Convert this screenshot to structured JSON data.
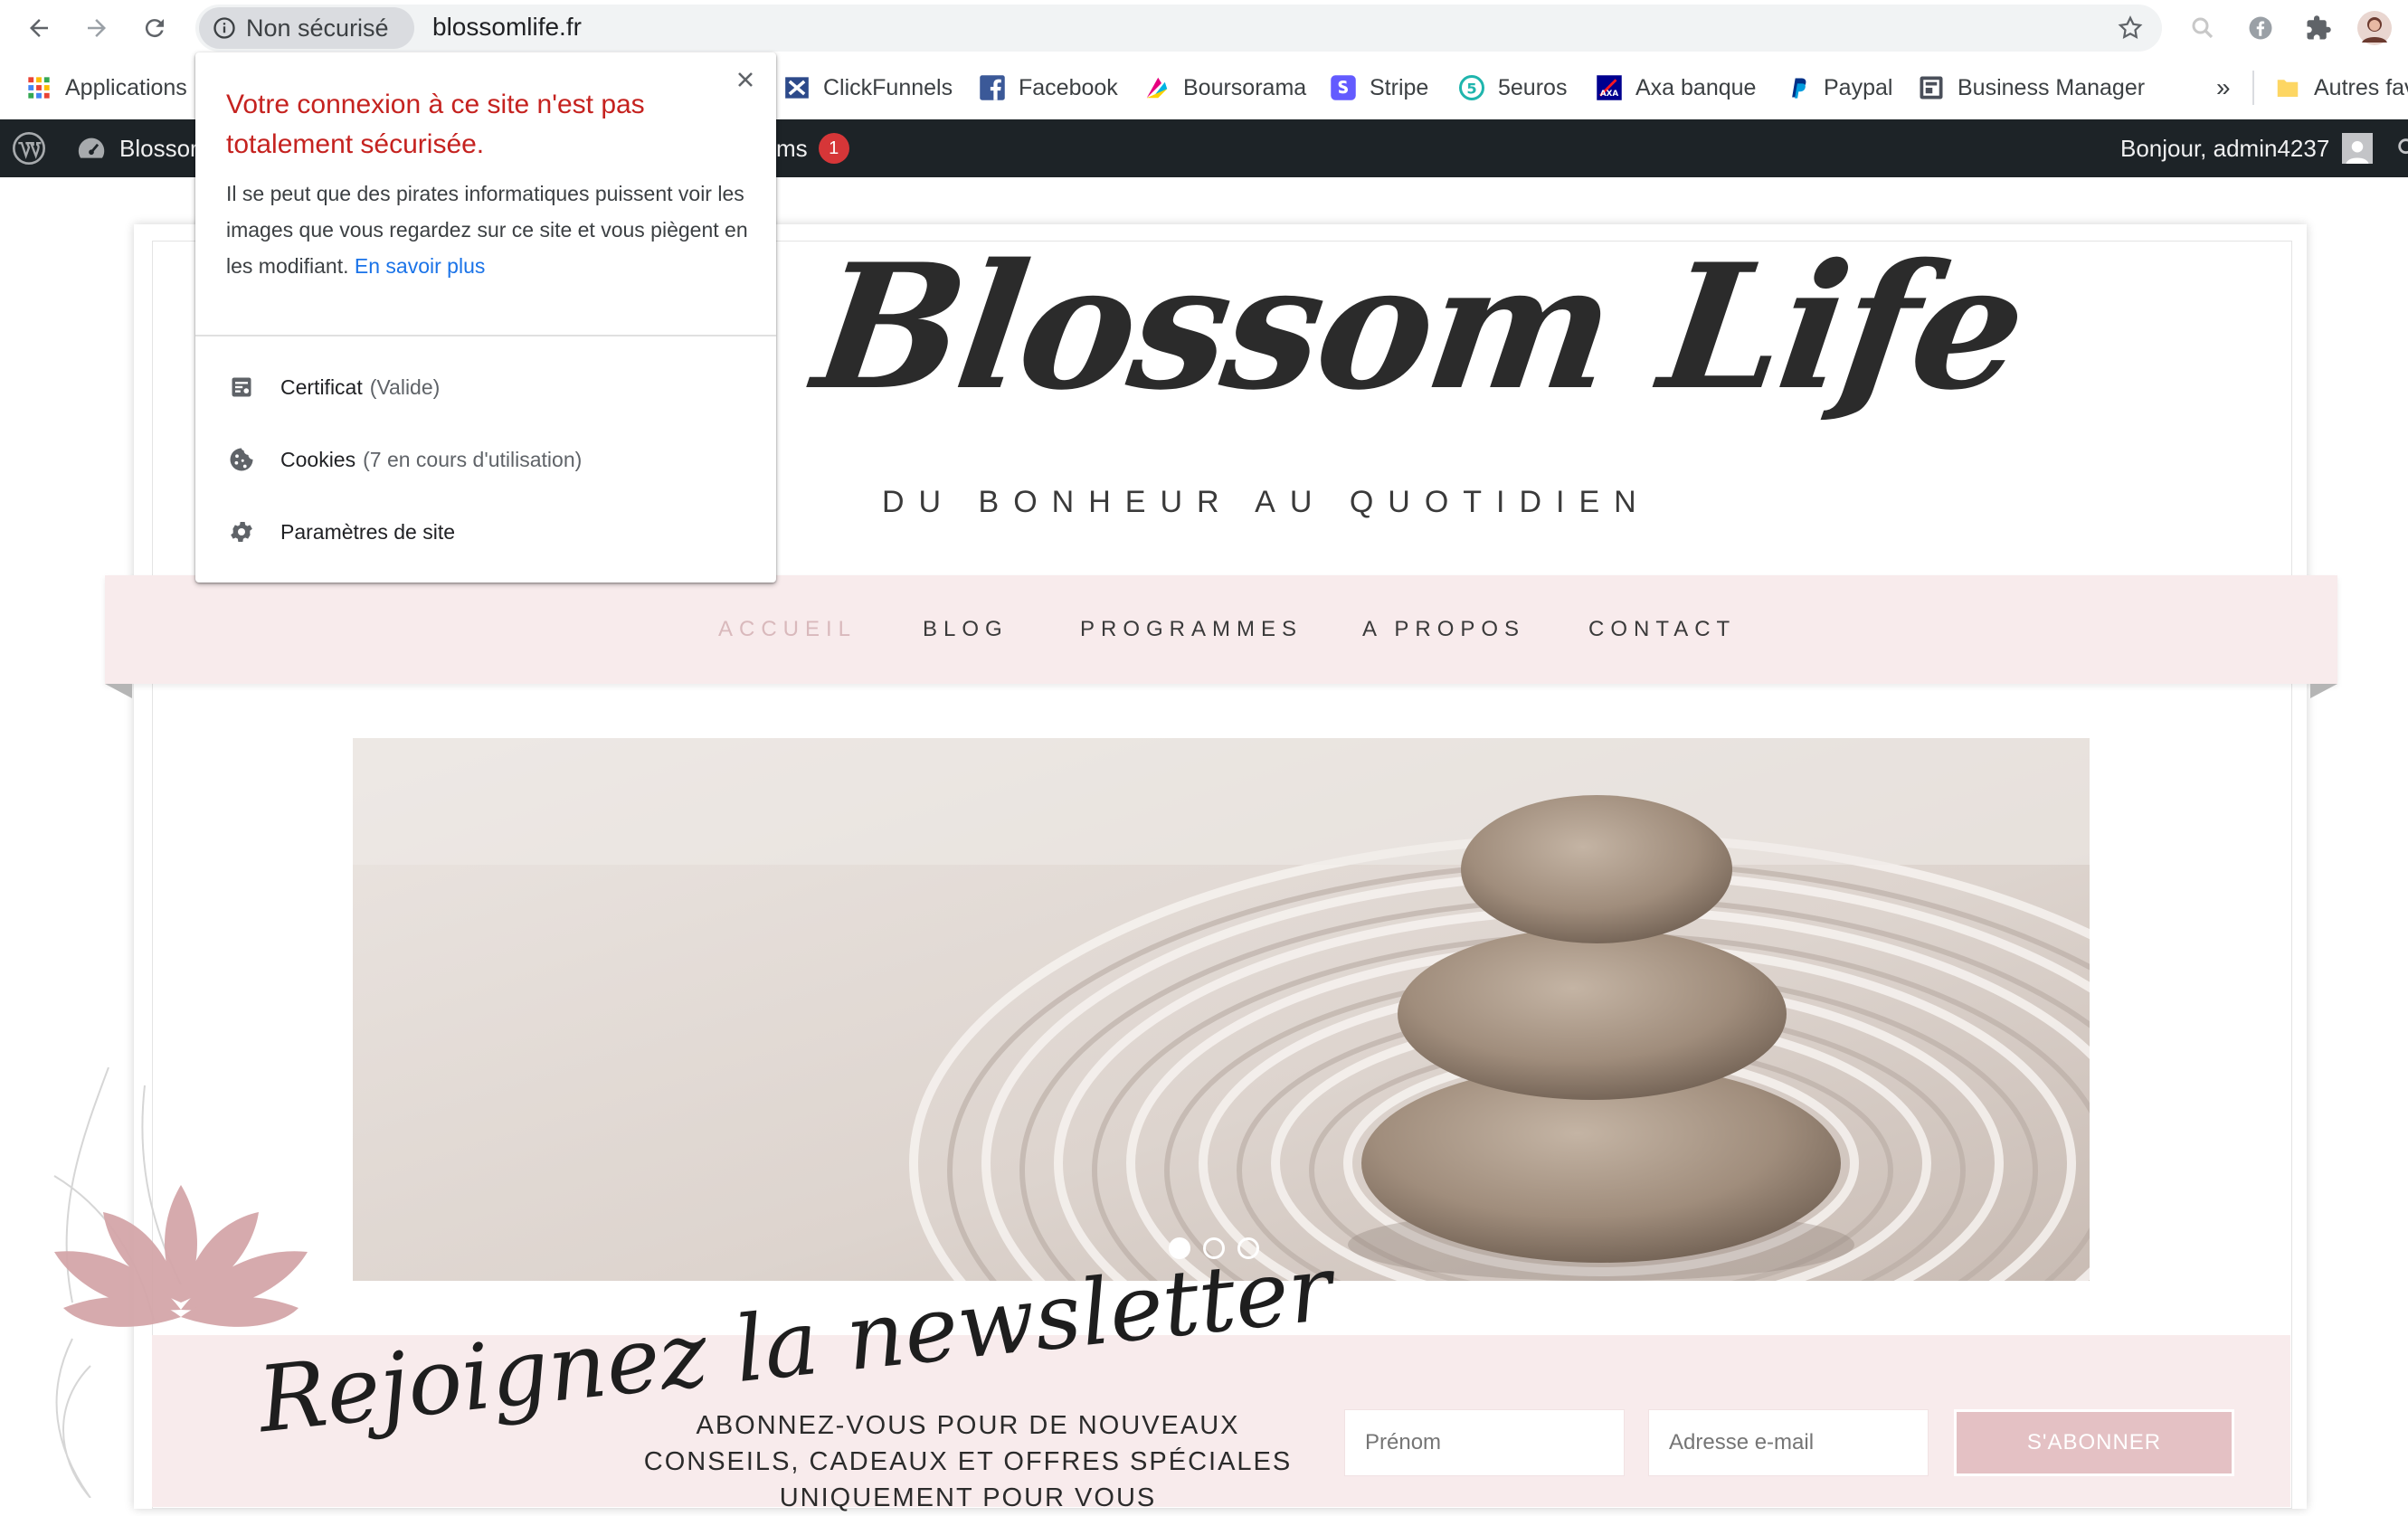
{
  "browser": {
    "security_label": "Non sécurisé",
    "url": "blossomlife.fr"
  },
  "bookmarks": [
    {
      "label": "Applications",
      "icon": "apps-grid-icon"
    },
    {
      "label": "ClickFunnels",
      "icon": "clickfunnels-icon"
    },
    {
      "label": "Facebook",
      "icon": "facebook-icon"
    },
    {
      "label": "Boursorama",
      "icon": "boursorama-icon"
    },
    {
      "label": "Stripe",
      "icon": "stripe-icon"
    },
    {
      "label": "5euros",
      "icon": "5euros-icon"
    },
    {
      "label": "Axa banque",
      "icon": "axa-icon"
    },
    {
      "label": "Paypal",
      "icon": "paypal-icon"
    },
    {
      "label": "Business Manager",
      "icon": "business-manager-icon"
    }
  ],
  "bookmarks_more": "»",
  "bookmarks_other": "Autres fav",
  "wp_admin": {
    "site_label": "Blossor",
    "partial_label": "ms",
    "badge": "1",
    "greeting": "Bonjour, admin4237"
  },
  "site": {
    "logo": "Blossom Life",
    "tagline": "DU BONHEUR AU QUOTIDIEN",
    "menu": [
      "ACCUEIL",
      "BLOG",
      "PROGRAMMES",
      "A PROPOS",
      "CONTACT"
    ],
    "active_menu_index": 0,
    "slider_dots": 3,
    "active_dot_index": 0
  },
  "newsletter": {
    "script_title": "Rejoignez la newsletter",
    "text": "ABONNEZ-VOUS POUR DE NOUVEAUX CONSEILS, CADEAUX ET OFFRES SPÉCIALES UNIQUEMENT POUR VOUS",
    "first_name_placeholder": "Prénom",
    "email_placeholder": "Adresse e-mail",
    "button": "S'ABONNER"
  },
  "popup": {
    "title": "Votre connexion à ce site n'est pas totalement sécurisée.",
    "body": "Il se peut que des pirates informatiques puissent voir les images que vous regardez sur ce site et vous piègent en les modifiant.",
    "link": "En savoir plus",
    "certificate": "Certificat",
    "certificate_status": "(Valide)",
    "cookies": "Cookies",
    "cookies_status": "(7 en cours d'utilisation)",
    "site_settings": "Paramètres de site"
  },
  "colors": {
    "accent_pink": "#f8ebec",
    "button_pink": "#e4c1c4",
    "warning_red": "#c5221f",
    "link_blue": "#1a73e8",
    "wp_bar": "#1d2327"
  }
}
